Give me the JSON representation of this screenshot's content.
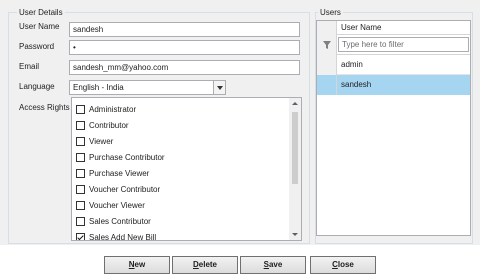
{
  "user_details": {
    "title": "User Details",
    "username_label": "User Name",
    "username_value": "sandesh",
    "password_label": "Password",
    "password_value": "•",
    "email_label": "Email",
    "email_value": "sandesh_mm@yahoo.com",
    "language_label": "Language",
    "language_value": "English - India",
    "access_rights_label": "Access Rights",
    "access_rights": [
      {
        "label": "Administrator",
        "checked": false
      },
      {
        "label": "Contributor",
        "checked": false
      },
      {
        "label": "Viewer",
        "checked": false
      },
      {
        "label": "Purchase Contributor",
        "checked": false
      },
      {
        "label": "Purchase Viewer",
        "checked": false
      },
      {
        "label": "Voucher Contributor",
        "checked": false
      },
      {
        "label": "Voucher Viewer",
        "checked": false
      },
      {
        "label": "Sales Contributor",
        "checked": false
      },
      {
        "label": "Sales Add New Bill",
        "checked": true
      }
    ]
  },
  "users": {
    "title": "Users",
    "column_header": "User Name",
    "filter_placeholder": "Type here to filter",
    "rows": [
      "admin",
      "sandesh"
    ],
    "selected_row": "sandesh"
  },
  "buttons": {
    "new_first": "N",
    "new_rest": "ew",
    "delete_first": "D",
    "delete_rest": "elete",
    "save_first": "S",
    "save_rest": "ave",
    "close_first": "C",
    "close_rest": "lose"
  },
  "colors": {
    "selection": "#a6d5f2",
    "panel": "#f0f0f0",
    "border": "#abadb3"
  }
}
